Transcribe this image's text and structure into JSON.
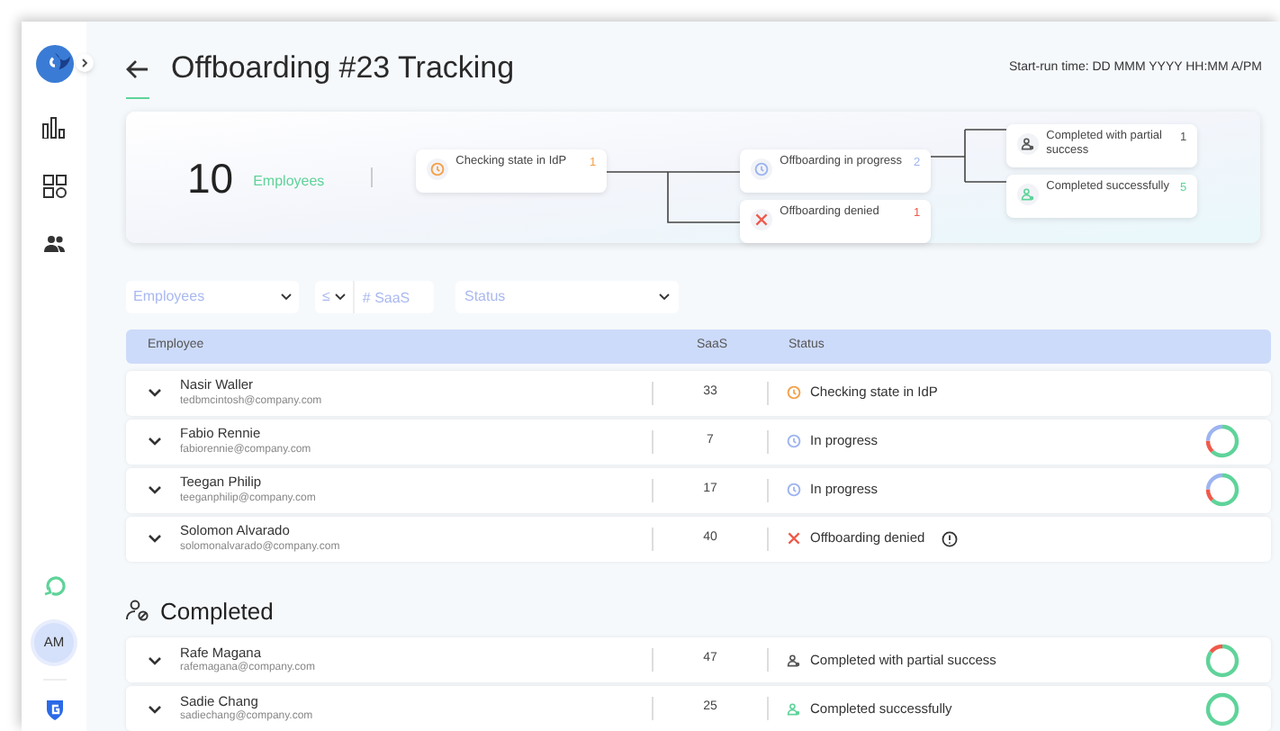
{
  "page": {
    "title": "Offboarding #23 Tracking",
    "start_time": "Start-run time: DD MMM YYYY HH:MM A/PM"
  },
  "sidebar": {
    "avatar": "AM"
  },
  "summary": {
    "count": "10",
    "label": "Employees",
    "flow": [
      {
        "kind": "checking",
        "label": "Checking state in IdP",
        "count": "1"
      },
      {
        "kind": "progress",
        "label": "Offboarding in progress",
        "count": "2"
      },
      {
        "kind": "denied",
        "label": "Offboarding denied",
        "count": "1"
      },
      {
        "kind": "partial",
        "label": "Completed with partial success",
        "count": "1"
      },
      {
        "kind": "success",
        "label": "Completed successfully",
        "count": "5"
      }
    ]
  },
  "filters": {
    "employees": "Employees",
    "operator": "≤",
    "saas": {
      "placeholder": "# SaaS"
    },
    "status": "Status"
  },
  "table": {
    "columns": [
      "Employee",
      "SaaS",
      "Status"
    ],
    "rows": [
      {
        "name": "Nasir Waller",
        "email": "tedbmcintosh@company.com",
        "saas": "33",
        "kind": "checking",
        "status": "Checking state in IdP",
        "info": false
      },
      {
        "name": "Fabio Rennie",
        "email": "fabiorennie@company.com",
        "saas": "7",
        "kind": "progress",
        "status": "In progress",
        "ring": {
          "kind": "mixed"
        },
        "info": false
      },
      {
        "name": "Teegan Philip",
        "email": "teeganphilip@company.com",
        "saas": "17",
        "kind": "progress",
        "status": "In progress",
        "ring": {
          "kind": "mixed"
        },
        "info": false
      },
      {
        "name": "Solomon Alvarado",
        "email": "solomonalvarado@company.com",
        "saas": "40",
        "kind": "denied",
        "status": "Offboarding denied",
        "info": true
      }
    ]
  },
  "completed": {
    "title": "Completed",
    "rows": [
      {
        "name": "Rafe Magana",
        "email": "rafemagana@company.com",
        "saas": "47",
        "kind": "partial",
        "status": "Completed with partial success",
        "ring": {
          "kind": "partial"
        },
        "info": false
      },
      {
        "name": "Sadie Chang",
        "email": "sadiechang@company.com",
        "saas": "25",
        "kind": "success",
        "status": "Completed successfully",
        "ring": {
          "kind": "full"
        },
        "info": false
      }
    ]
  }
}
